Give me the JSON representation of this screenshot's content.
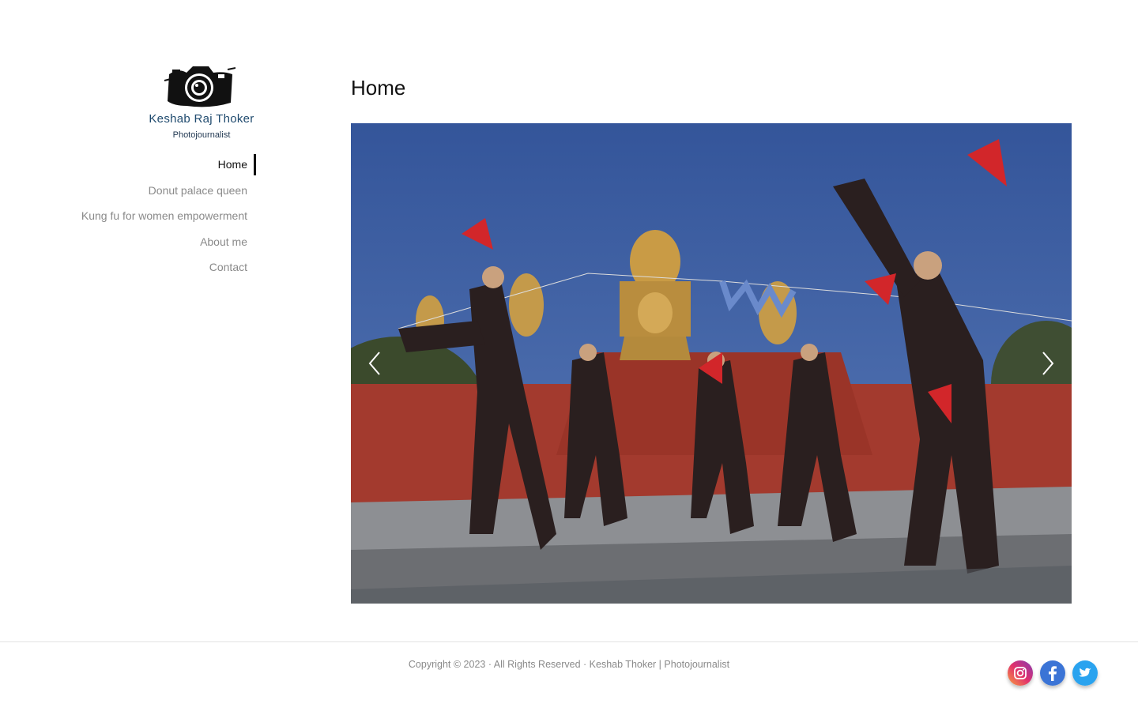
{
  "site": {
    "logo_name": "Keshab Raj Thoker",
    "logo_subtitle": "Photojournalist"
  },
  "nav": {
    "items": [
      {
        "label": "Home",
        "active": true
      },
      {
        "label": "Donut palace queen",
        "active": false
      },
      {
        "label": "Kung fu for women empowerment",
        "active": false
      },
      {
        "label": "About me",
        "active": false
      },
      {
        "label": "Contact",
        "active": false
      }
    ]
  },
  "main": {
    "title": "Home",
    "slider": {
      "prev_icon": "chevron-left-icon",
      "next_icon": "chevron-right-icon"
    }
  },
  "footer": {
    "copyright": "Copyright © 2023 · All Rights Reserved · Keshab Thoker | Photojournalist",
    "social": [
      {
        "name": "instagram",
        "icon": "instagram-icon"
      },
      {
        "name": "facebook",
        "icon": "facebook-icon"
      },
      {
        "name": "twitter",
        "icon": "twitter-icon"
      }
    ]
  },
  "colors": {
    "nav_inactive": "#8a8a8a",
    "nav_active": "#111111",
    "logo_blue": "#1f4a6e",
    "sky": "#3e5f9e"
  }
}
